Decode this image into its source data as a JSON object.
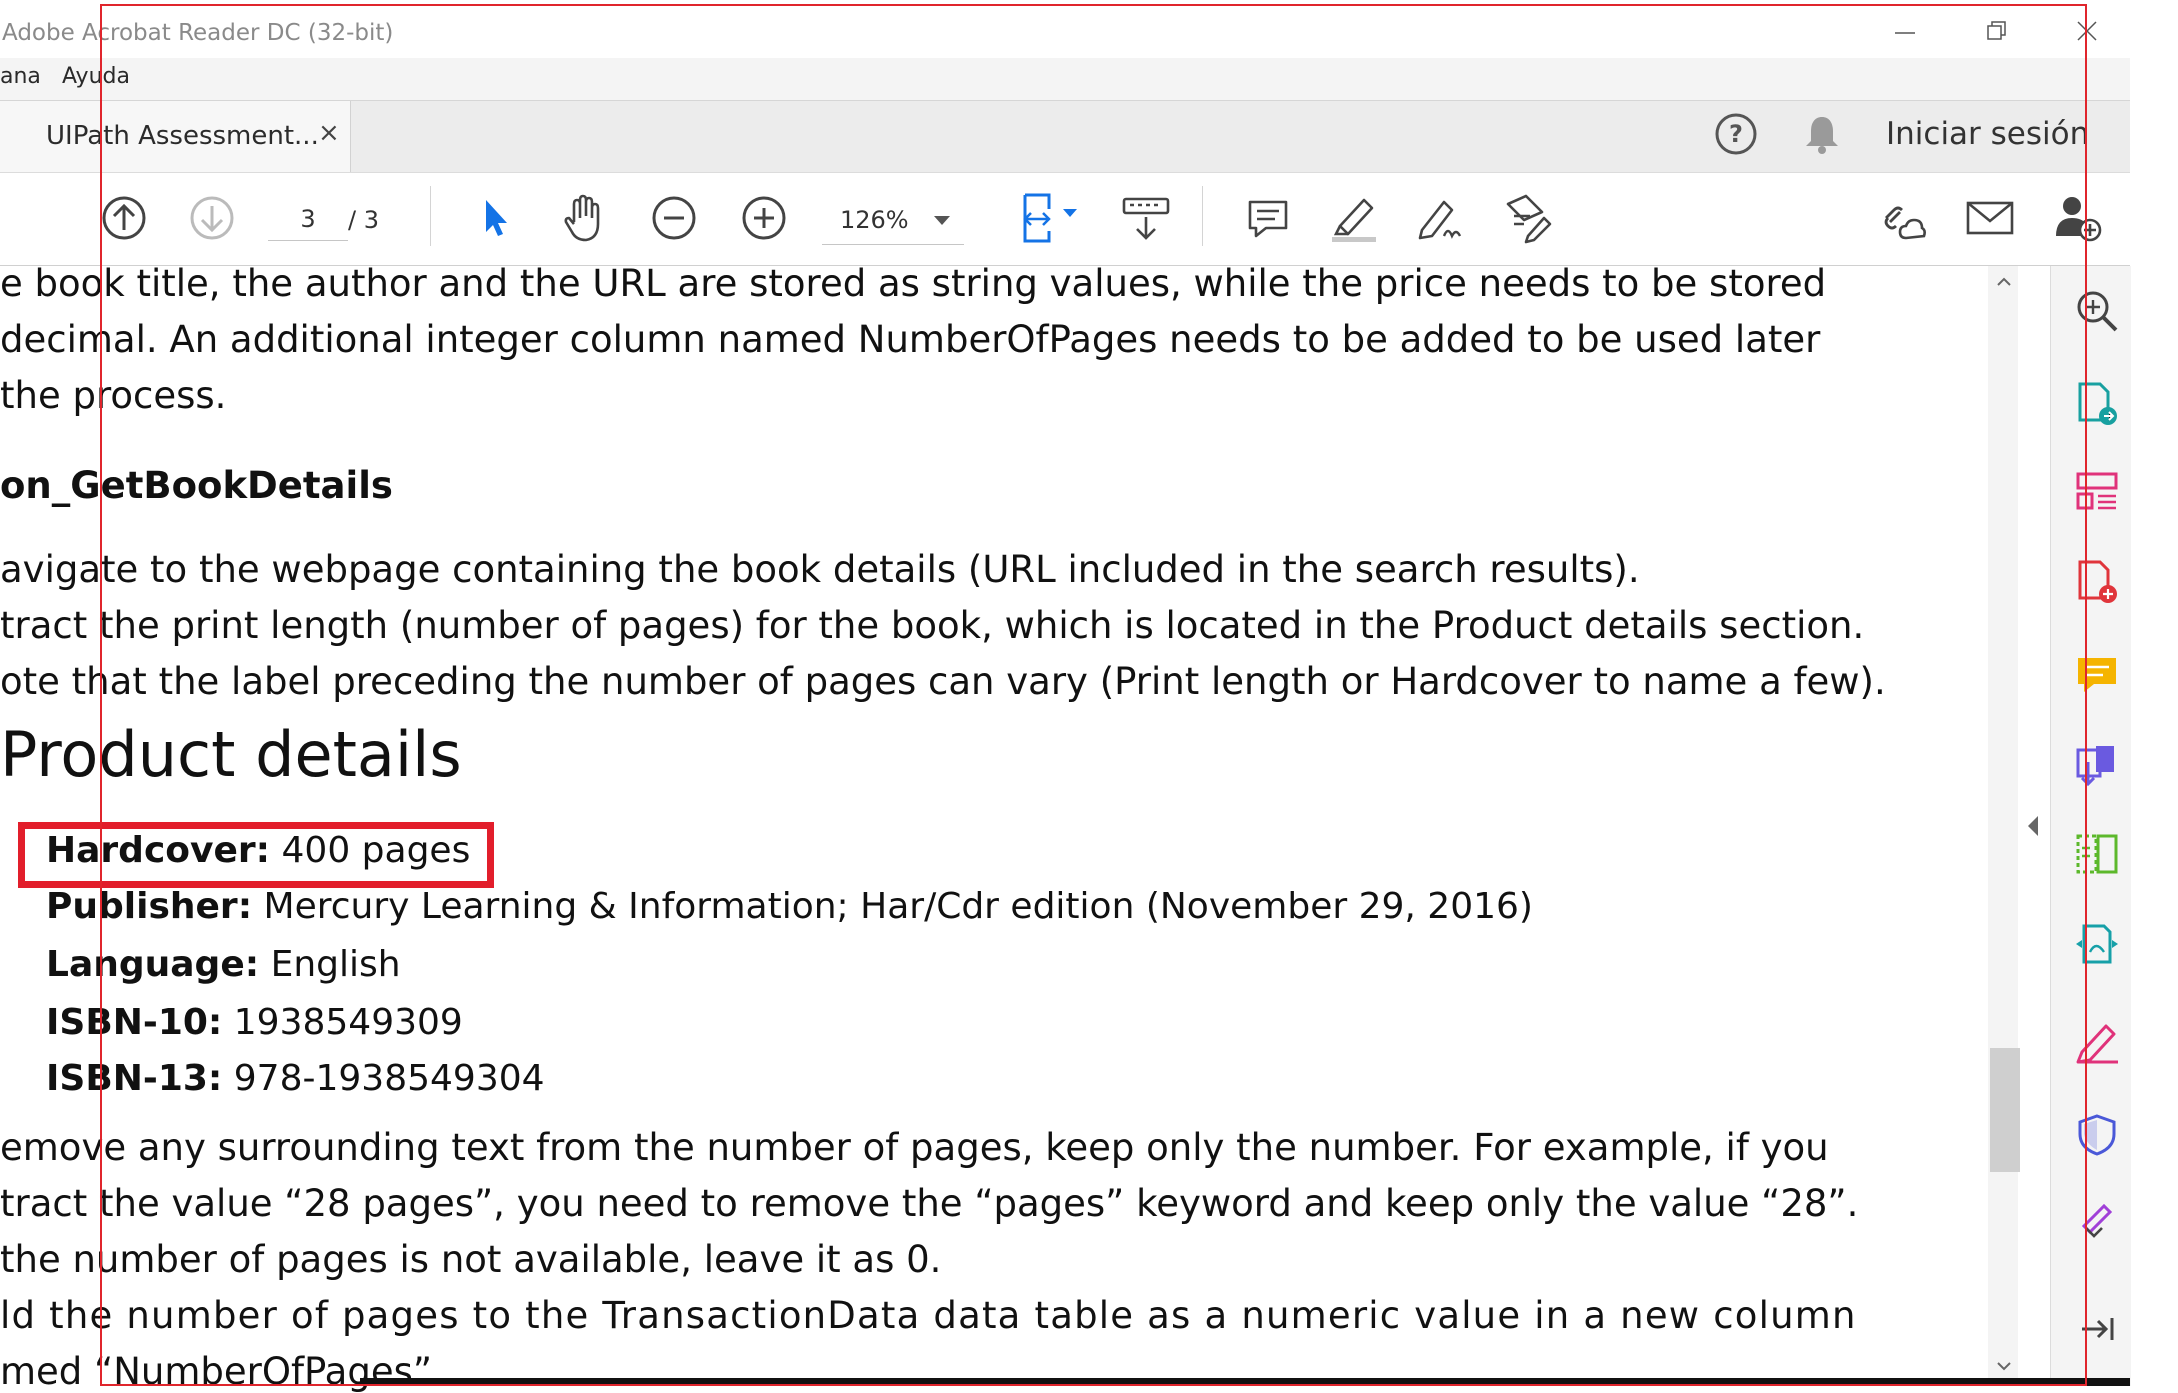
{
  "window": {
    "title": "Adobe Acrobat Reader DC (32-bit)"
  },
  "menu": {
    "items": [
      "ana",
      "Ayuda"
    ]
  },
  "tab": {
    "title": "UIPath Assessment...",
    "close": "×"
  },
  "header": {
    "signin": "Iniciar sesión"
  },
  "toolbar": {
    "page_current": "3",
    "page_total": "/ 3",
    "zoom": "126%"
  },
  "document": {
    "intro": [
      "e book title, the author and the URL are stored as string values, while the price needs to be stored",
      " decimal. An additional integer column named NumberOfPages needs to be added to be used later",
      "the process."
    ],
    "heading": "on_GetBookDetails",
    "steps": [
      "avigate to the webpage containing the book details (URL included in the search results).",
      "tract the print length (number of pages) for the book, which is located in the Product details section.",
      "ote that the label preceding the number of pages can vary (Print length or Hardcover to name a few)."
    ],
    "product_details": {
      "title": "Product details",
      "rows": [
        {
          "label": "Hardcover:",
          "value": "400 pages"
        },
        {
          "label": "Publisher:",
          "value": "Mercury Learning & Information; Har/Cdr edition (November 29, 2016)"
        },
        {
          "label": "Language:",
          "value": "English"
        },
        {
          "label": "ISBN-10:",
          "value": "1938549309"
        },
        {
          "label": "ISBN-13:",
          "value": "978-1938549304"
        }
      ]
    },
    "outro": [
      "emove any surrounding text from the number of pages, keep only the number. For example, if you",
      "tract the value “28 pages”, you need to remove the “pages” keyword and keep only the value “28”.",
      "the number of pages is not available, leave it as 0.",
      "ld the number of pages to the TransactionData data table as a numeric value in a new column",
      "med “NumberOfPages”."
    ]
  },
  "colors": {
    "highlight": "#e21e2b",
    "toolbar_blue": "#1473e6"
  }
}
